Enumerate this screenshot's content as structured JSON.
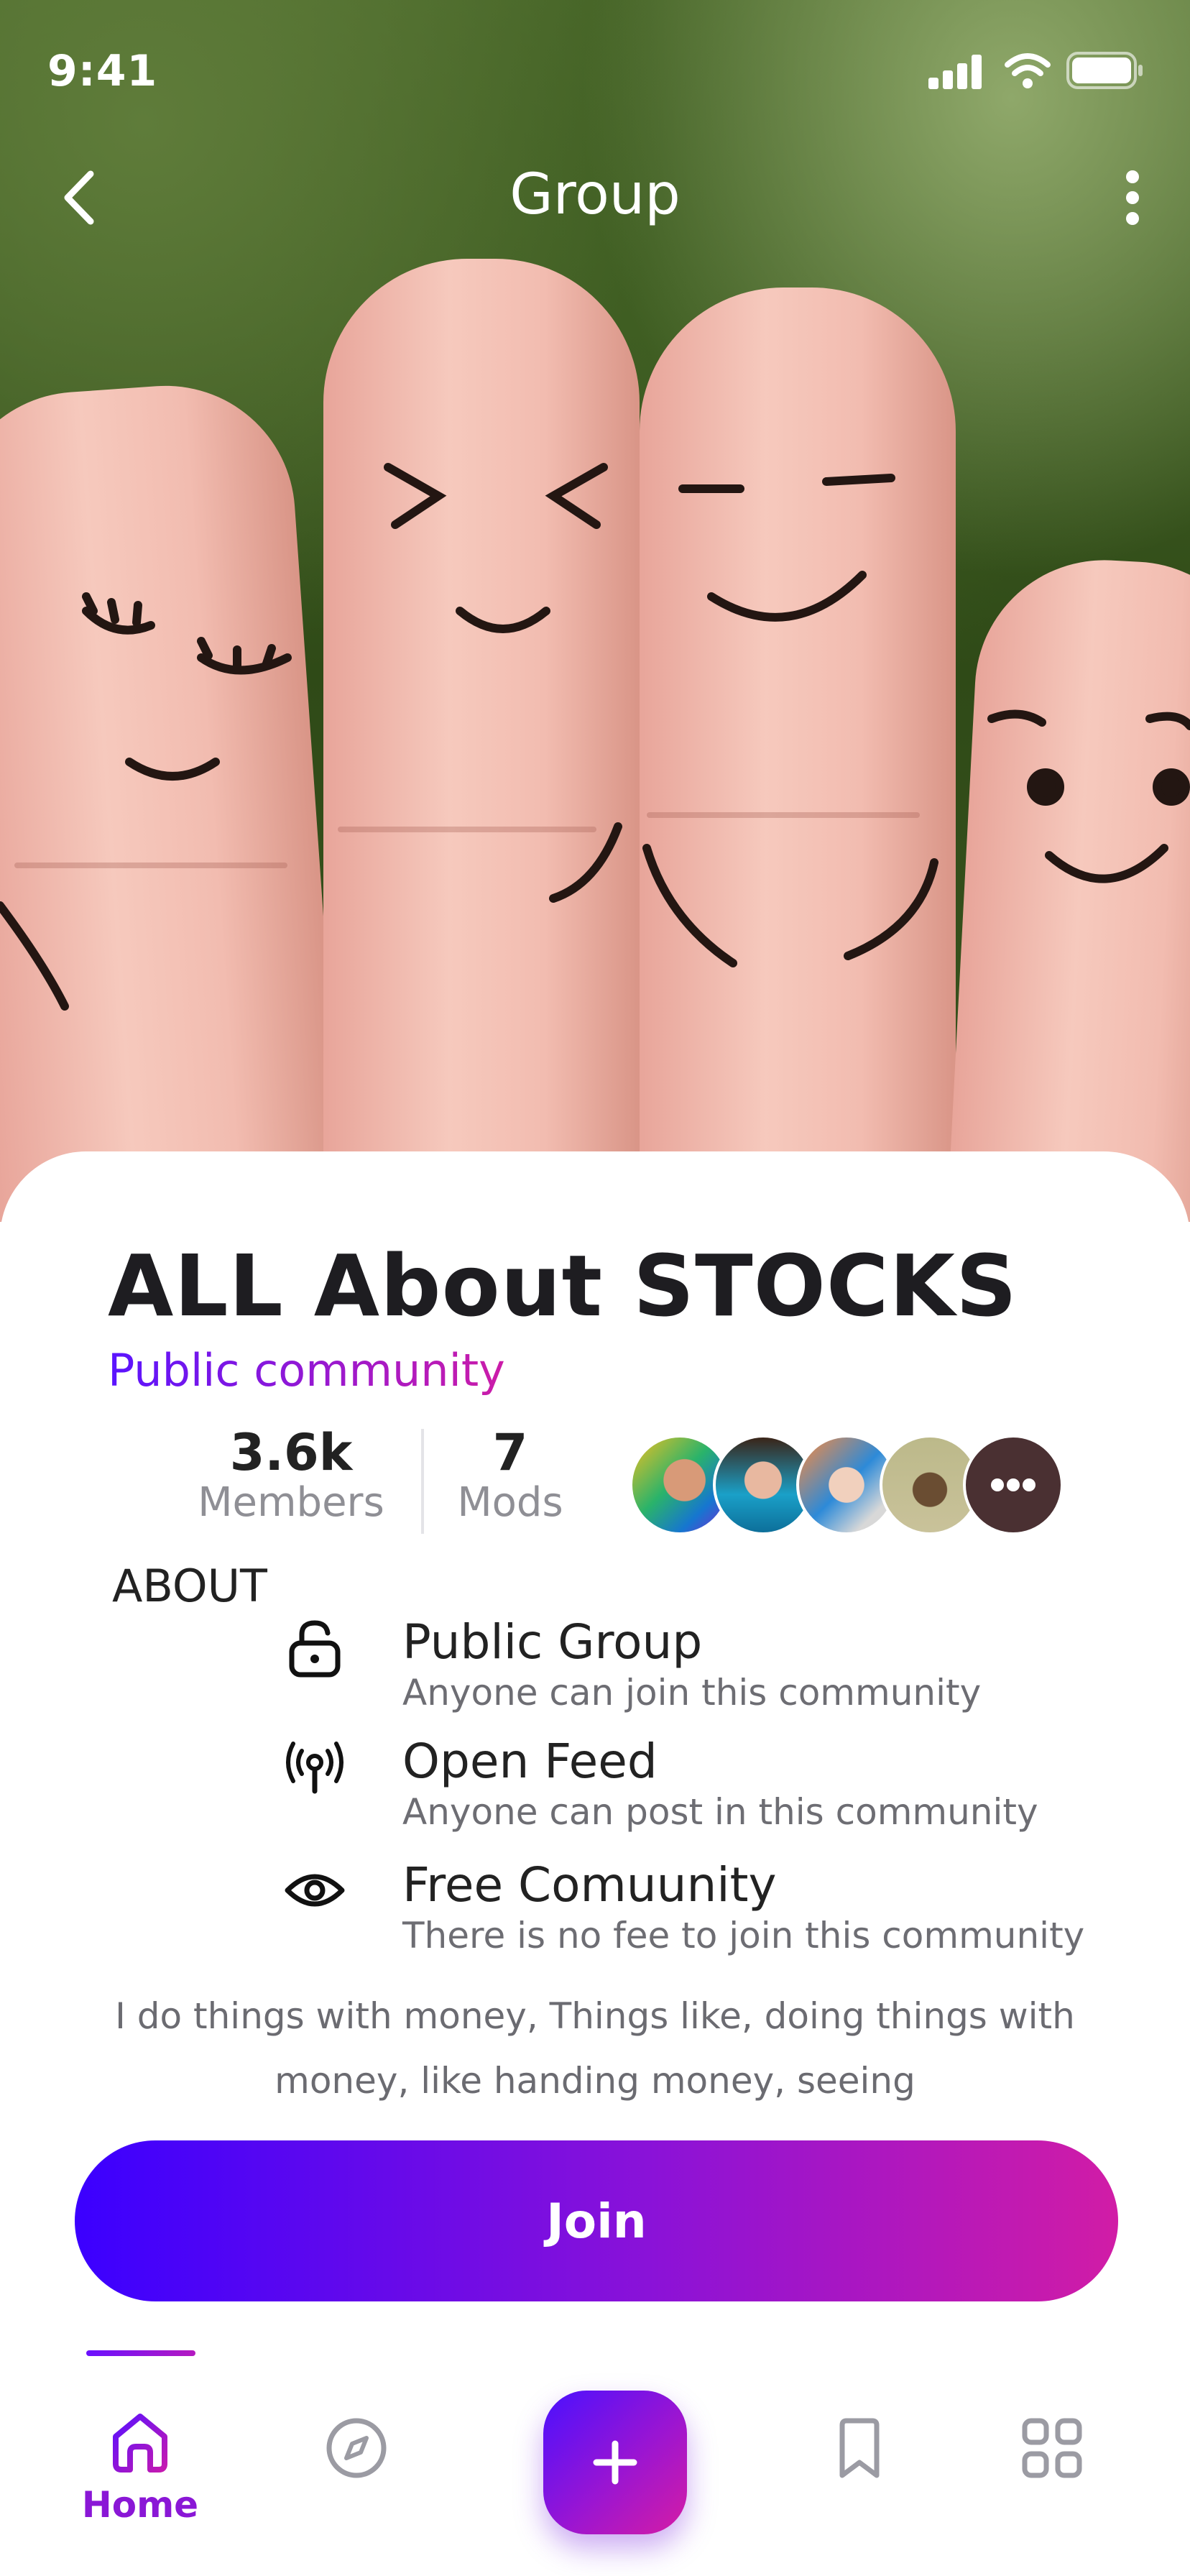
{
  "status_bar": {
    "time": "9:41"
  },
  "header": {
    "title": "Group"
  },
  "group": {
    "name": "ALL About STOCKS",
    "type": "Public community",
    "members_count": "3.6k",
    "members_label": "Members",
    "mods_count": "7",
    "mods_label": "Mods"
  },
  "about": {
    "heading": "ABOUT",
    "features": [
      {
        "icon": "unlock-icon",
        "title": "Public Group",
        "subtitle": "Anyone can join this community"
      },
      {
        "icon": "broadcast-icon",
        "title": "Open Feed",
        "subtitle": "Anyone can post in this community"
      },
      {
        "icon": "eye-icon",
        "title": "Free Comuunity",
        "subtitle": "There is no fee to join this community"
      }
    ],
    "description": "I do things with money, Things like, doing things with money, like handing money, seeing"
  },
  "join_label": "Join",
  "bottom_nav": {
    "items": [
      {
        "icon": "home-icon",
        "label": "Home",
        "active": true
      },
      {
        "icon": "compass-icon"
      },
      {
        "icon": "plus-icon"
      },
      {
        "icon": "bookmark-icon"
      },
      {
        "icon": "grid-icon"
      }
    ]
  },
  "colors": {
    "accent_start": "#3b00ff",
    "accent_end": "#d11ca6",
    "text_dark": "#1e1d21",
    "text_muted": "#8f8f95"
  }
}
